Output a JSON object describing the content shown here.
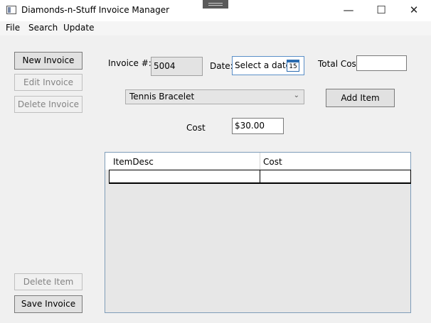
{
  "window": {
    "title": "Diamonds-n-Stuff Invoice Manager",
    "minimize_glyph": "—",
    "maximize_glyph": "☐",
    "close_glyph": "✕"
  },
  "menu": [
    "File",
    "Search",
    "Update"
  ],
  "left_panel": {
    "new_invoice": "New Invoice",
    "edit_invoice": "Edit Invoice",
    "delete_invoice": "Delete Invoice",
    "delete_item": "Delete Item",
    "save_invoice": "Save Invoice"
  },
  "header": {
    "invoice_label": "Invoice #:",
    "invoice_number": "5004",
    "date_label": "Date:",
    "date_placeholder": "Select a date",
    "calendar_day": "15",
    "total_cost_label": "Total Cost:",
    "total_cost_value": ""
  },
  "item": {
    "selected": "Tennis Bracelet",
    "add_item": "Add Item",
    "cost_label": "Cost",
    "cost_value": "$30.00"
  },
  "grid": {
    "columns": [
      "ItemDesc",
      "Cost"
    ],
    "rows": []
  },
  "icons": {
    "app": "app-window-icon",
    "calendar": "calendar-icon",
    "dropdown": "chevron-down-icon"
  }
}
